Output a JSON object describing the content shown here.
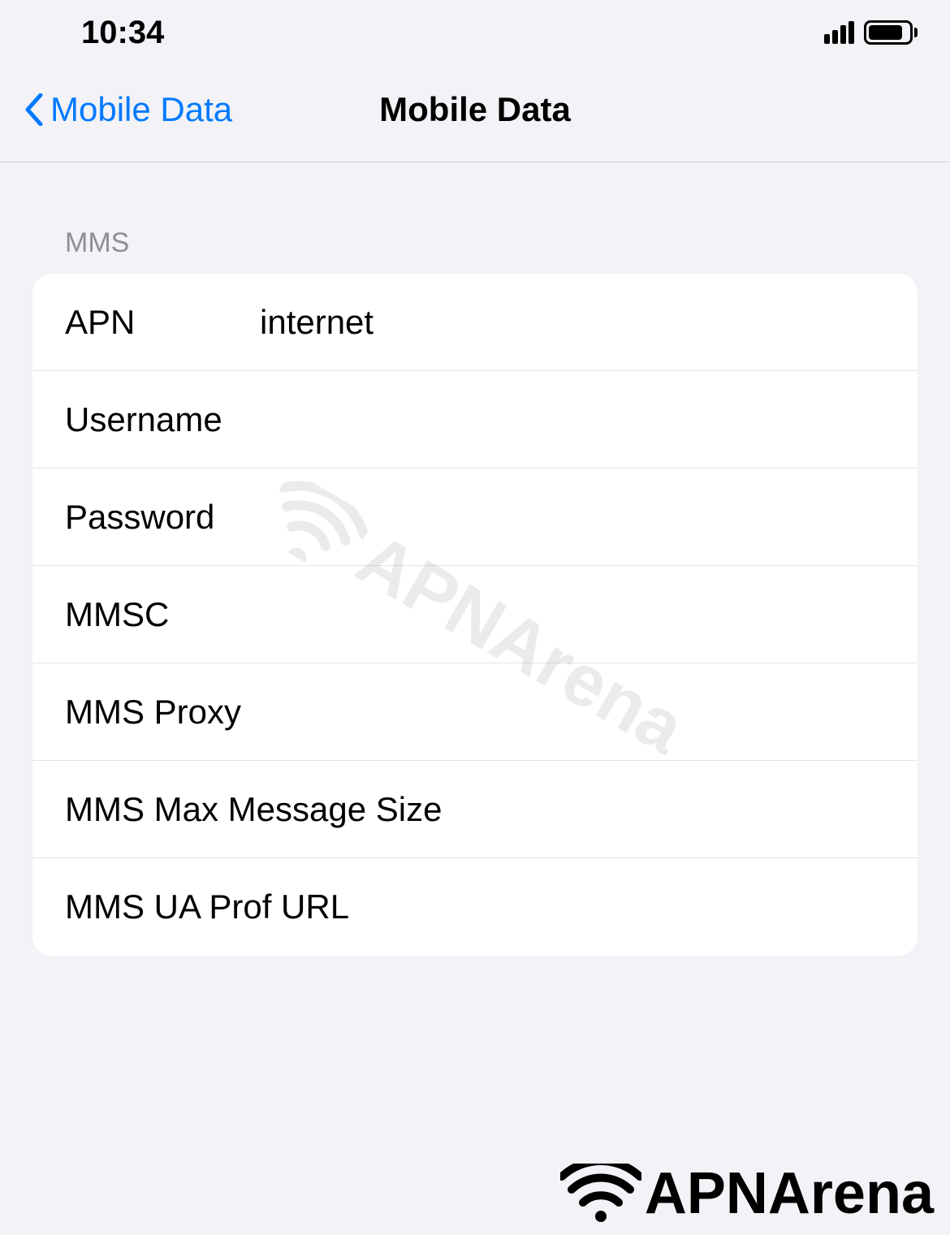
{
  "statusBar": {
    "time": "10:34"
  },
  "navBar": {
    "backLabel": "Mobile Data",
    "title": "Mobile Data"
  },
  "section": {
    "header": "MMS"
  },
  "fields": {
    "apn": {
      "label": "APN",
      "value": "internet"
    },
    "username": {
      "label": "Username",
      "value": ""
    },
    "password": {
      "label": "Password",
      "value": ""
    },
    "mmsc": {
      "label": "MMSC",
      "value": ""
    },
    "mmsProxy": {
      "label": "MMS Proxy",
      "value": ""
    },
    "mmsMaxSize": {
      "label": "MMS Max Message Size",
      "value": ""
    },
    "mmsUaProf": {
      "label": "MMS UA Prof URL",
      "value": ""
    }
  },
  "watermark": "APNArena",
  "brand": "APNArena"
}
